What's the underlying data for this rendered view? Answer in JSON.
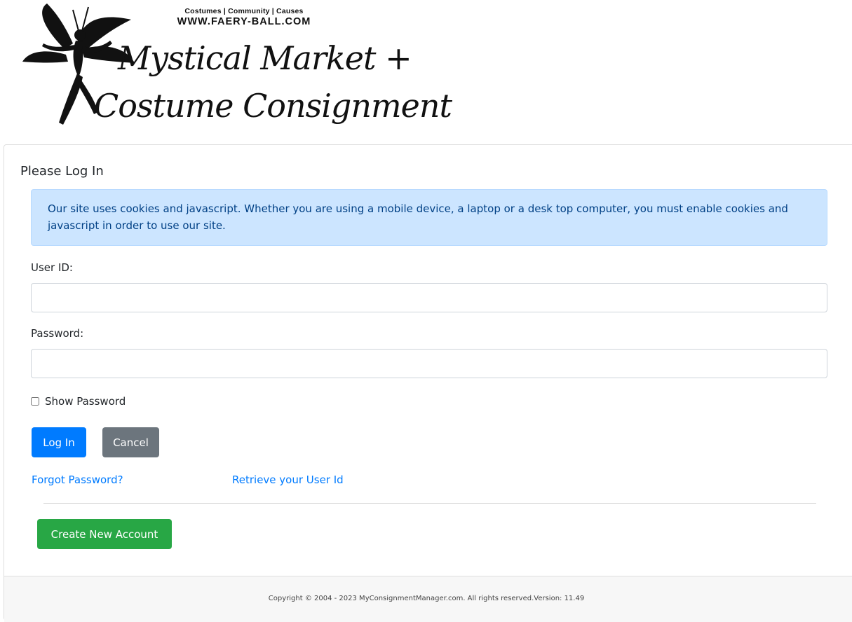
{
  "header": {
    "tagline": "Costumes | Community | Causes",
    "site_url": "WWW.FAERY-BALL.COM",
    "logo_line1": "Mystical Market +",
    "logo_line2": "Costume Consignment"
  },
  "login": {
    "title": "Please Log In",
    "notice": "Our site uses cookies and javascript. Whether you are using a mobile device, a laptop or a desk top computer, you must enable cookies and javascript in order to use our site.",
    "user_id_label": "User ID:",
    "user_id_value": "",
    "password_label": "Password:",
    "password_value": "",
    "show_password_label": "Show Password",
    "show_password_checked": false,
    "login_button": "Log In",
    "cancel_button": "Cancel",
    "forgot_password_link": "Forgot Password?",
    "retrieve_user_id_link": "Retrieve your User Id",
    "create_account_button": "Create New Account"
  },
  "footer": {
    "copyright": "Copyright © 2004 - 2023 MyConsignmentManager.com. All rights reserved.Version: 11.49"
  },
  "colors": {
    "primary": "#007bff",
    "secondary": "#6c757d",
    "success": "#28a745",
    "info_bg": "#cce5ff",
    "info_text": "#004085"
  }
}
